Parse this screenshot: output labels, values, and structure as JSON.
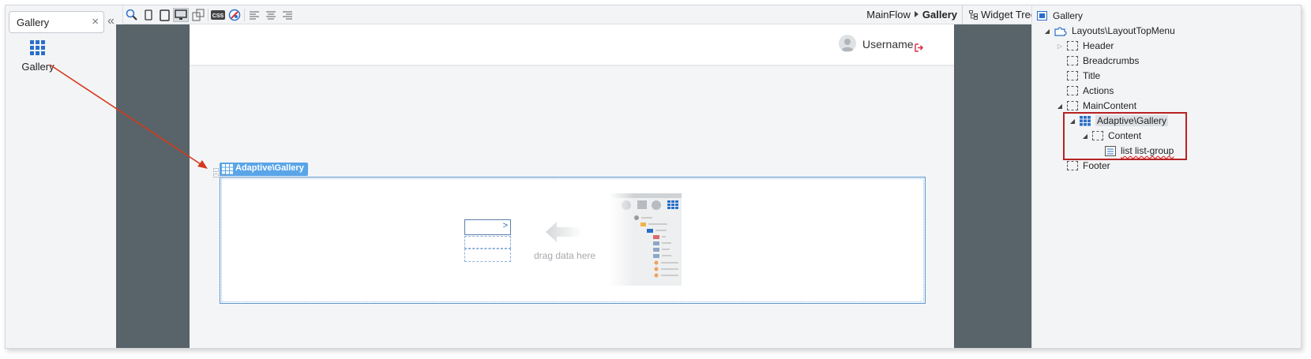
{
  "toolbox": {
    "search_value": "Gallery",
    "clear_glyph": "×",
    "collapse_glyph": "«",
    "widget_label": "Gallery"
  },
  "toolbar": {
    "icons": [
      "preview-icon",
      "phone-icon",
      "tablet-icon",
      "desktop-icon",
      "swap-device-icon",
      "css-icon",
      "theme-icon",
      "align-left-icon",
      "align-center-icon",
      "align-right-icon"
    ],
    "css_label": "CSS"
  },
  "breadcrumb": {
    "flow": "MainFlow",
    "screen": "Gallery"
  },
  "widget_tree_tab": "Widget Tree",
  "canvas": {
    "username": "Username",
    "gallery_tag": "Adaptive\\Gallery",
    "drag_hint": "drag data here",
    "card_glyph": ">"
  },
  "tree": {
    "root": "Gallery",
    "layout": "Layouts\\LayoutTopMenu",
    "header": "Header",
    "breadcrumbs": "Breadcrumbs",
    "title": "Title",
    "actions": "Actions",
    "main_content": "MainContent",
    "gallery": "Adaptive\\Gallery",
    "content": "Content",
    "list": "list list-group",
    "footer": "Footer"
  },
  "colors": {
    "accent_blue": "#5aa5e8",
    "canvas_bg": "#586469",
    "annotation_red": "#d63a1e",
    "highlight_red": "#b82222"
  }
}
